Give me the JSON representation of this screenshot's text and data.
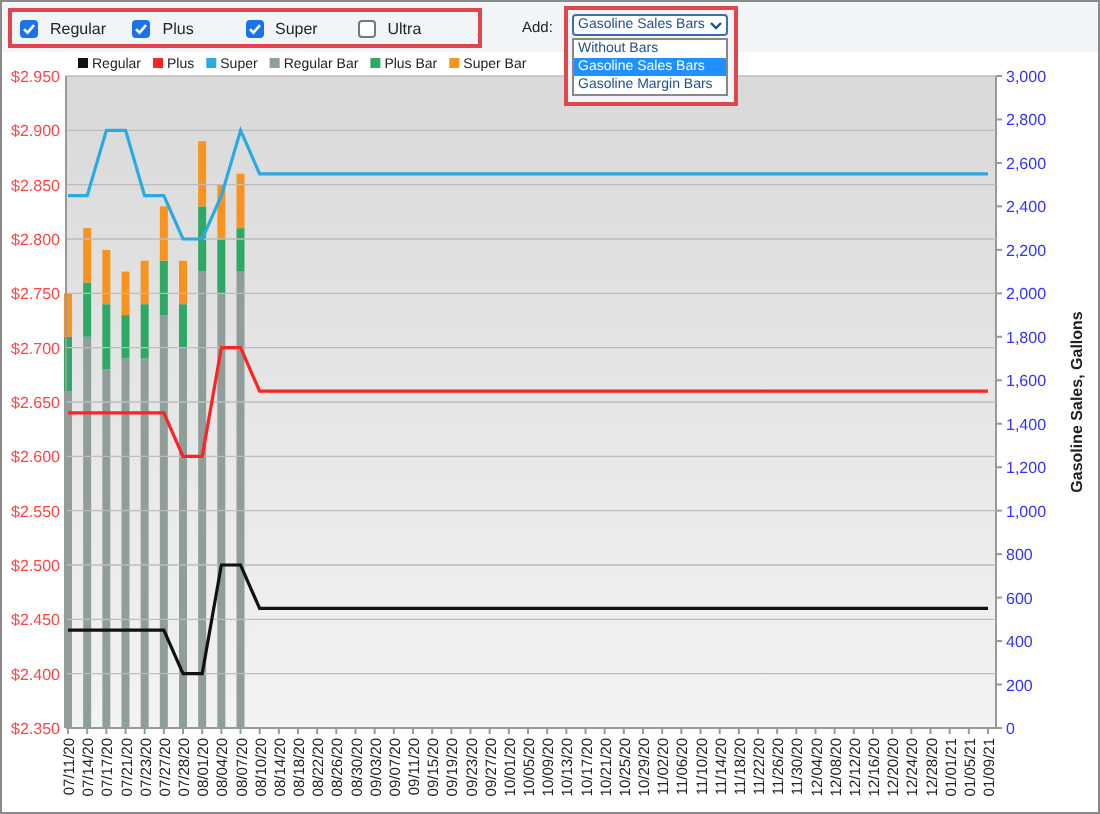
{
  "filters": [
    {
      "label": "Regular",
      "checked": true
    },
    {
      "label": "Plus",
      "checked": true
    },
    {
      "label": "Super",
      "checked": true
    },
    {
      "label": "Ultra",
      "checked": false
    }
  ],
  "add": {
    "label": "Add:",
    "value": "Gasoline Sales Bars",
    "expanded": true,
    "options": [
      {
        "label": "Without Bars",
        "selected": false
      },
      {
        "label": "Gasoline Sales Bars",
        "selected": true
      },
      {
        "label": "Gasoline Margin Bars",
        "selected": false
      }
    ]
  },
  "price_chart": {
    "chart_data": {
      "type": "line",
      "grid": true,
      "legend": "top",
      "categories": [
        "07/11/20",
        "07/14/20",
        "07/17/20",
        "07/21/20",
        "07/23/20",
        "07/27/20",
        "07/28/20",
        "08/01/20",
        "08/04/20",
        "08/07/20",
        "08/10/20",
        "08/14/20",
        "08/18/20",
        "08/22/20",
        "08/26/20",
        "08/30/20",
        "09/03/20",
        "09/07/20",
        "09/11/20",
        "09/15/20",
        "09/19/20",
        "09/23/20",
        "09/27/20",
        "10/01/20",
        "10/05/20",
        "10/09/20",
        "10/13/20",
        "10/17/20",
        "10/21/20",
        "10/25/20",
        "10/29/20",
        "11/02/20",
        "11/06/20",
        "11/10/20",
        "11/14/20",
        "11/18/20",
        "11/22/20",
        "11/26/20",
        "11/30/20",
        "12/04/20",
        "12/08/20",
        "12/12/20",
        "12/16/20",
        "12/20/20",
        "12/24/20",
        "12/28/20",
        "01/01/21",
        "01/05/21",
        "01/09/21"
      ],
      "ylim": [
        2.35,
        2.95
      ],
      "yticks": [
        {
          "value": 2.35,
          "label": "$2.350"
        },
        {
          "value": 2.4,
          "label": "$2.400"
        },
        {
          "value": 2.45,
          "label": "$2.450"
        },
        {
          "value": 2.5,
          "label": "$2.500"
        },
        {
          "value": 2.55,
          "label": "$2.550"
        },
        {
          "value": 2.6,
          "label": "$2.600"
        },
        {
          "value": 2.65,
          "label": "$2.650"
        },
        {
          "value": 2.7,
          "label": "$2.700"
        },
        {
          "value": 2.75,
          "label": "$2.750"
        },
        {
          "value": 2.8,
          "label": "$2.800"
        },
        {
          "value": 2.85,
          "label": "$2.850"
        },
        {
          "value": 2.9,
          "label": "$2.900"
        },
        {
          "value": 2.95,
          "label": "$2.950"
        }
      ],
      "series": [
        {
          "name": "Regular",
          "color": "#111111",
          "values": [
            2.44,
            2.44,
            2.44,
            2.44,
            2.44,
            2.44,
            2.4,
            2.4,
            2.5,
            2.5,
            2.46,
            2.46,
            2.46,
            2.46,
            2.46,
            2.46,
            2.46,
            2.46,
            2.46,
            2.46,
            2.46,
            2.46,
            2.46,
            2.46,
            2.46,
            2.46,
            2.46,
            2.46,
            2.46,
            2.46,
            2.46,
            2.46,
            2.46,
            2.46,
            2.46,
            2.46,
            2.46,
            2.46,
            2.46,
            2.46,
            2.46,
            2.46,
            2.46,
            2.46,
            2.46,
            2.46,
            2.46,
            2.46,
            2.46
          ]
        },
        {
          "name": "Plus",
          "color": "#ff2222",
          "values": [
            2.64,
            2.64,
            2.64,
            2.64,
            2.64,
            2.64,
            2.6,
            2.6,
            2.7,
            2.7,
            2.66,
            2.66,
            2.66,
            2.66,
            2.66,
            2.66,
            2.66,
            2.66,
            2.66,
            2.66,
            2.66,
            2.66,
            2.66,
            2.66,
            2.66,
            2.66,
            2.66,
            2.66,
            2.66,
            2.66,
            2.66,
            2.66,
            2.66,
            2.66,
            2.66,
            2.66,
            2.66,
            2.66,
            2.66,
            2.66,
            2.66,
            2.66,
            2.66,
            2.66,
            2.66,
            2.66,
            2.66,
            2.66,
            2.66
          ]
        },
        {
          "name": "Super",
          "color": "#29abe2",
          "values": [
            2.84,
            2.84,
            2.9,
            2.9,
            2.84,
            2.84,
            2.8,
            2.8,
            2.84,
            2.9,
            2.86,
            2.86,
            2.86,
            2.86,
            2.86,
            2.86,
            2.86,
            2.86,
            2.86,
            2.86,
            2.86,
            2.86,
            2.86,
            2.86,
            2.86,
            2.86,
            2.86,
            2.86,
            2.86,
            2.86,
            2.86,
            2.86,
            2.86,
            2.86,
            2.86,
            2.86,
            2.86,
            2.86,
            2.86,
            2.86,
            2.86,
            2.86,
            2.86,
            2.86,
            2.86,
            2.86,
            2.86,
            2.86,
            2.86
          ]
        }
      ]
    }
  },
  "sales_chart": {
    "chart_data": {
      "type": "bar",
      "stacked": true,
      "legend": "top",
      "ylabel": "Gasoline Sales, Gallons",
      "ylim": [
        0,
        3000
      ],
      "yticks": [
        {
          "value": 0,
          "label": "0"
        },
        {
          "value": 200,
          "label": "200"
        },
        {
          "value": 400,
          "label": "400"
        },
        {
          "value": 600,
          "label": "600"
        },
        {
          "value": 800,
          "label": "800"
        },
        {
          "value": 1000,
          "label": "1,000"
        },
        {
          "value": 1200,
          "label": "1,200"
        },
        {
          "value": 1400,
          "label": "1,400"
        },
        {
          "value": 1600,
          "label": "1,600"
        },
        {
          "value": 1800,
          "label": "1,800"
        },
        {
          "value": 2000,
          "label": "2,000"
        },
        {
          "value": 2200,
          "label": "2,200"
        },
        {
          "value": 2400,
          "label": "2,400"
        },
        {
          "value": 2600,
          "label": "2,600"
        },
        {
          "value": 2800,
          "label": "2,800"
        },
        {
          "value": 3000,
          "label": "3,000"
        }
      ],
      "series": [
        {
          "name": "Regular Bar",
          "color": "#8f9e9a",
          "values": [
            1550,
            1800,
            1650,
            1700,
            1700,
            1900,
            1750,
            2100,
            2000,
            2100,
            null,
            null,
            null,
            null,
            null,
            null,
            null,
            null,
            null,
            null,
            null,
            null,
            null,
            null,
            null,
            null,
            null,
            null,
            null,
            null,
            null,
            null,
            null,
            null,
            null,
            null,
            null,
            null,
            null,
            null,
            null,
            null,
            null,
            null,
            null,
            null,
            null,
            null,
            null
          ]
        },
        {
          "name": "Plus Bar",
          "color": "#2ea865",
          "values": [
            250,
            250,
            300,
            200,
            250,
            250,
            200,
            300,
            250,
            200,
            null,
            null,
            null,
            null,
            null,
            null,
            null,
            null,
            null,
            null,
            null,
            null,
            null,
            null,
            null,
            null,
            null,
            null,
            null,
            null,
            null,
            null,
            null,
            null,
            null,
            null,
            null,
            null,
            null,
            null,
            null,
            null,
            null,
            null,
            null,
            null,
            null,
            null,
            null
          ]
        },
        {
          "name": "Super Bar",
          "color": "#f7931e",
          "values": [
            200,
            250,
            250,
            200,
            200,
            250,
            200,
            300,
            250,
            250,
            null,
            null,
            null,
            null,
            null,
            null,
            null,
            null,
            null,
            null,
            null,
            null,
            null,
            null,
            null,
            null,
            null,
            null,
            null,
            null,
            null,
            null,
            null,
            null,
            null,
            null,
            null,
            null,
            null,
            null,
            null,
            null,
            null,
            null,
            null,
            null,
            null,
            null,
            null
          ]
        }
      ]
    }
  }
}
